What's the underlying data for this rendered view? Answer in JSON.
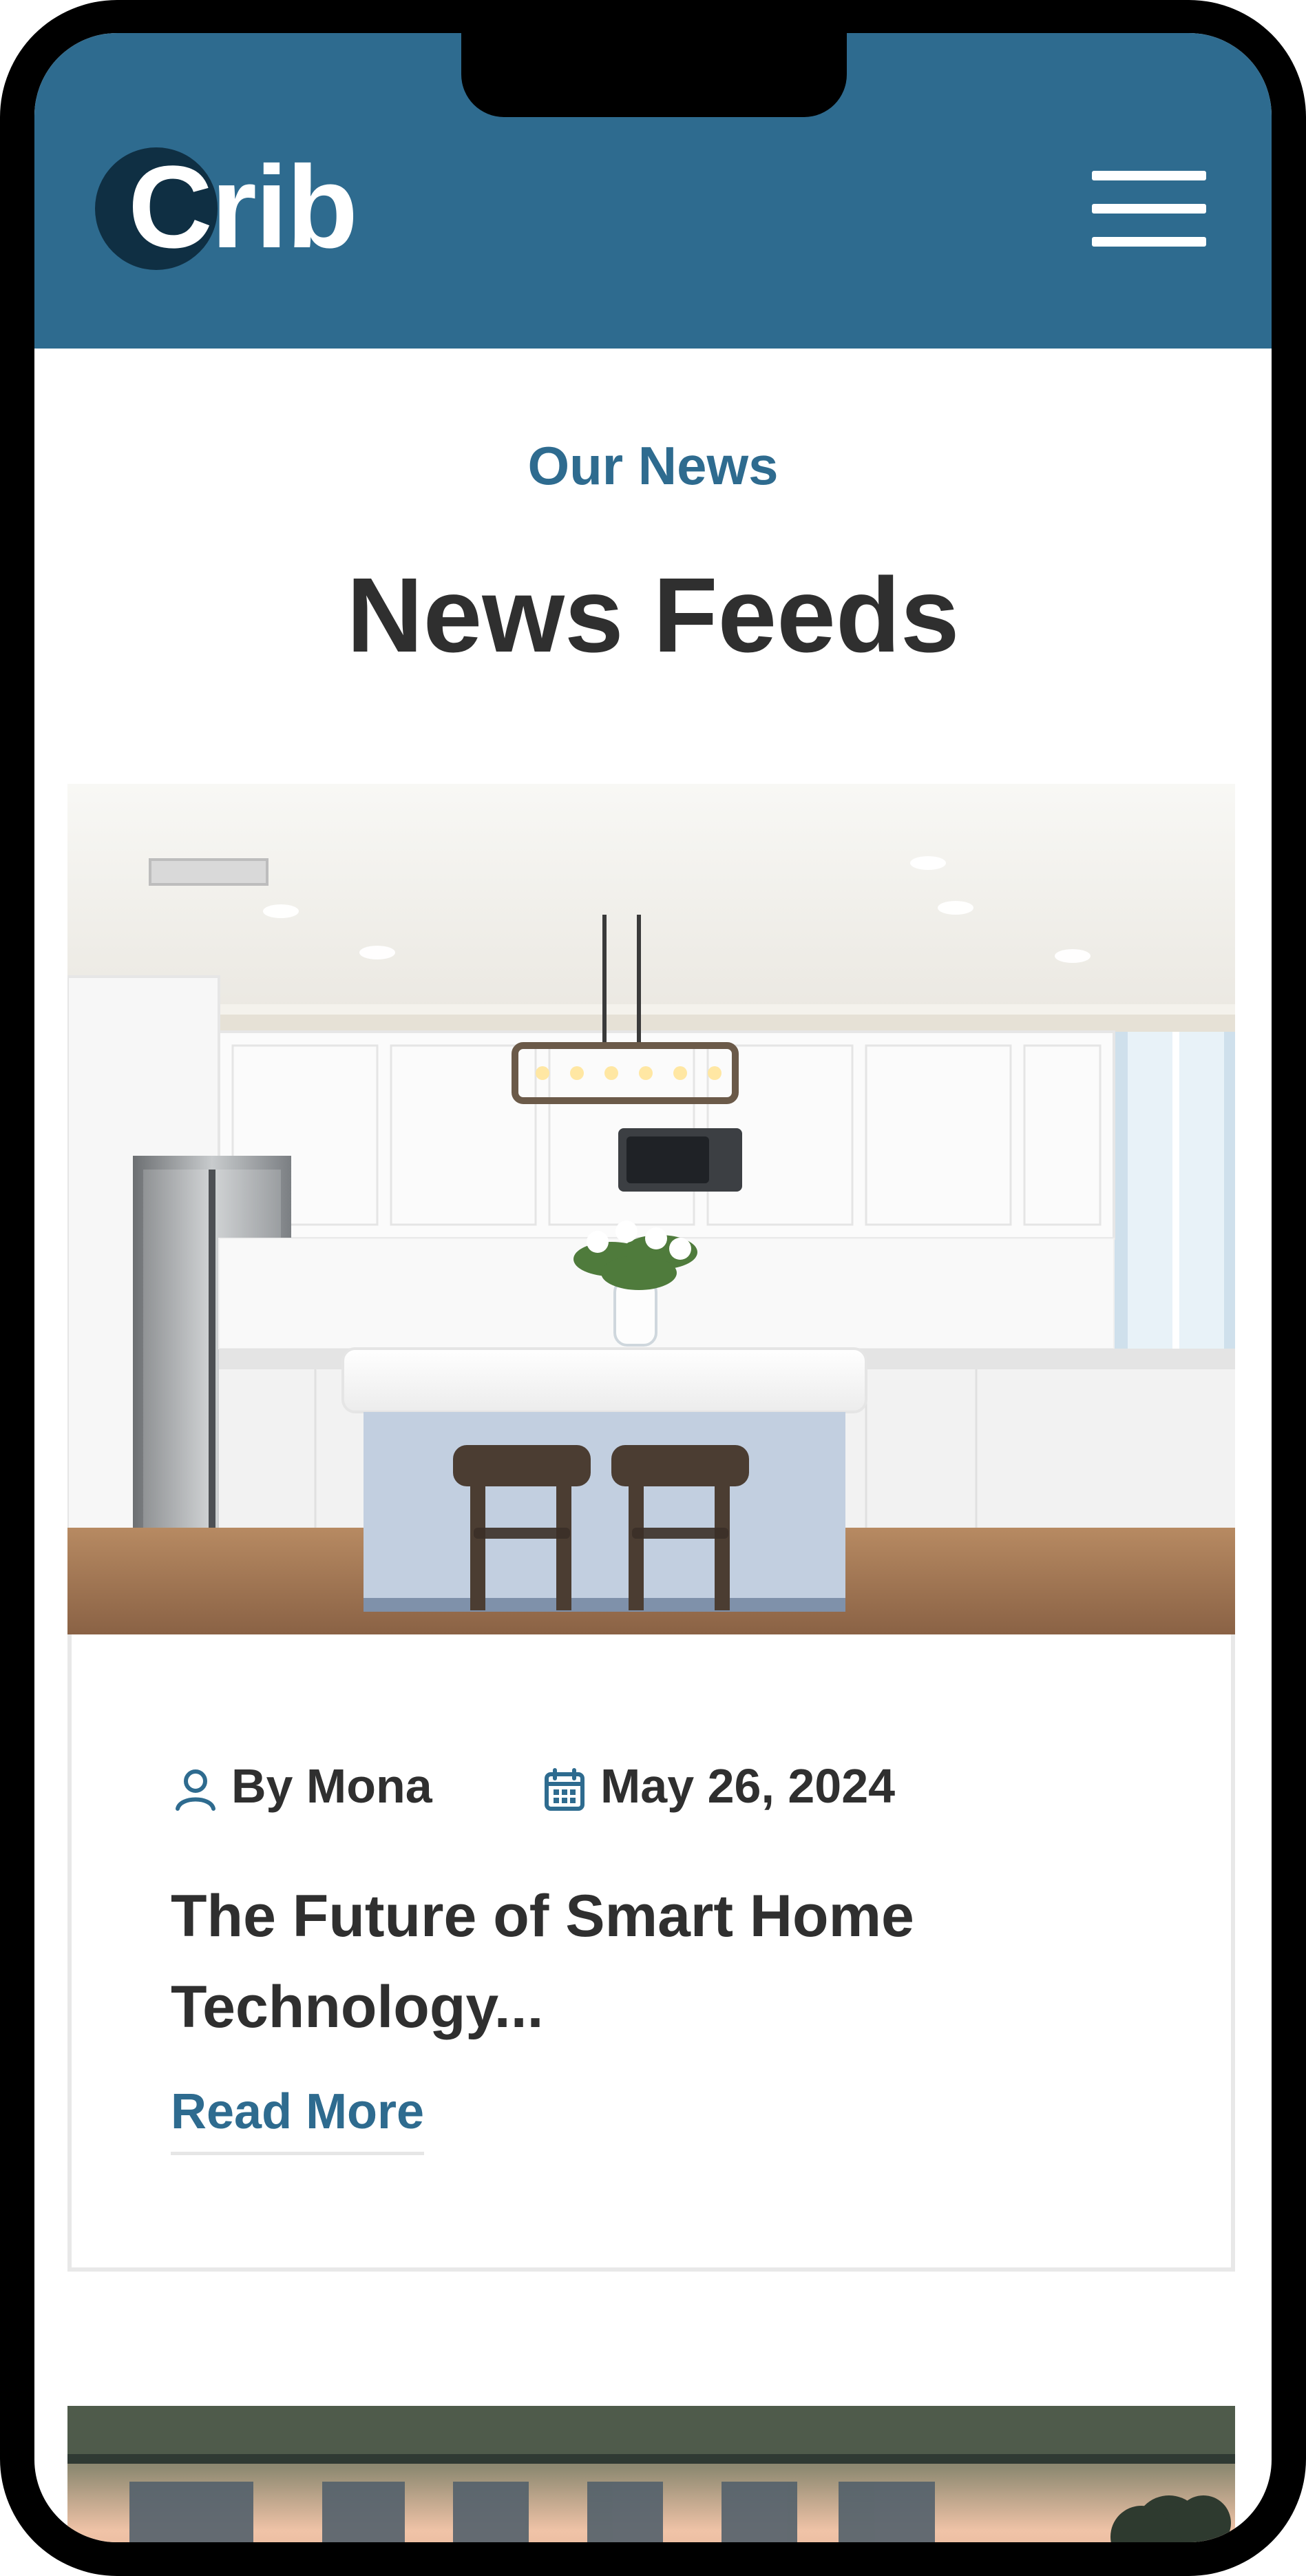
{
  "brand": {
    "name": "Crib",
    "header_color": "#2e6b8f",
    "accent_color": "#2e6b8f",
    "dark_circle_color": "#0f2f43"
  },
  "header": {
    "menu_icon": "hamburger-menu-icon"
  },
  "section": {
    "eyebrow": "Our News",
    "title": "News Feeds"
  },
  "news": [
    {
      "image_icon": "kitchen-photo",
      "author_icon": "user-icon",
      "author": "By Mona",
      "date_icon": "calendar-icon",
      "date": "May 26, 2024",
      "title": "The Future of Smart Home Technology...",
      "read_more": "Read More"
    },
    {
      "image_icon": "waterfront-photo"
    }
  ]
}
